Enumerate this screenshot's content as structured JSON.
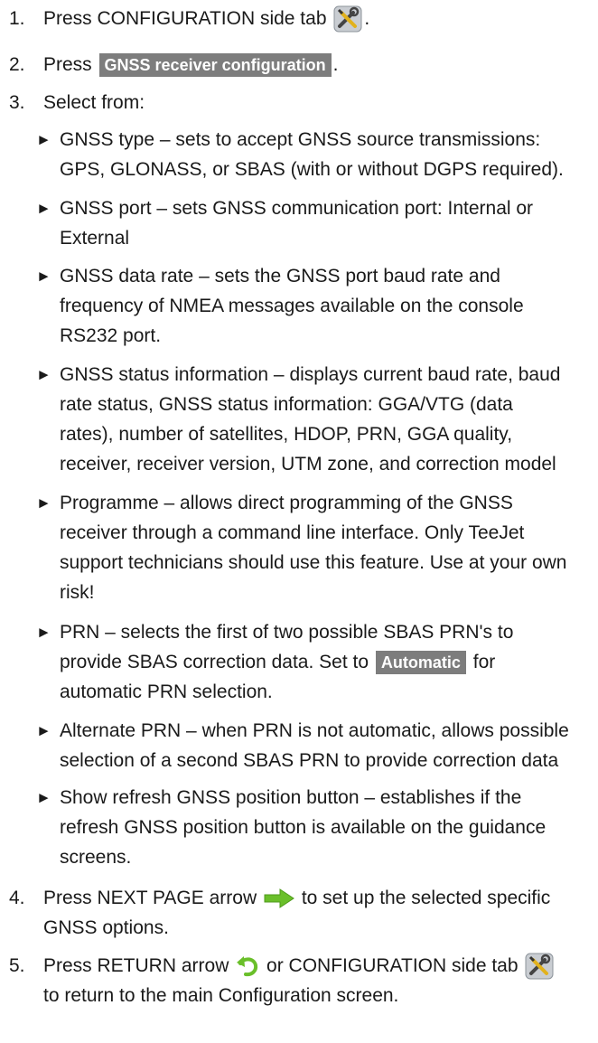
{
  "steps": [
    {
      "num": "1.",
      "parts": [
        "Press CONFIGURATION side tab",
        "."
      ]
    },
    {
      "num": "2.",
      "parts": [
        "Press",
        "."
      ],
      "button": "GNSS receiver configuration"
    },
    {
      "num": "3.",
      "text": "Select from:"
    },
    {
      "num": "4.",
      "parts": [
        "Press NEXT PAGE arrow",
        "to set up the selected specific",
        "GNSS options."
      ]
    },
    {
      "num": "5.",
      "parts": [
        "Press RETURN arrow",
        "or CONFIGURATION side tab",
        "to return to the main Configuration screen."
      ]
    }
  ],
  "bullets": [
    {
      "lines": [
        "GNSS type – sets to accept GNSS source transmissions:",
        "GPS, GLONASS, or SBAS (with or without DGPS required)."
      ]
    },
    {
      "lines": [
        "GNSS port – sets GNSS communication port: Internal or",
        "External"
      ]
    },
    {
      "lines": [
        "GNSS data rate – sets the GNSS port baud rate and",
        "frequency of NMEA messages available on the console",
        "RS232 port."
      ]
    },
    {
      "lines": [
        "GNSS status information – displays current baud rate, baud",
        "rate status, GNSS status information: GGA/VTG (data",
        "rates), number of satellites, HDOP, PRN, GGA quality,",
        "receiver, receiver version, UTM zone, and correction model"
      ]
    },
    {
      "lines": [
        "Programme – allows direct programming of the GNSS",
        "receiver through a command line interface. Only TeeJet",
        "support technicians should use this feature. Use at your own",
        "risk!"
      ]
    },
    {
      "lines": [
        "PRN – selects the first of two possible SBAS PRN's to",
        "provide SBAS correction data. Set to",
        "for",
        "automatic PRN selection."
      ],
      "button": "Automatic"
    },
    {
      "lines": [
        "Alternate PRN – when PRN is not automatic, allows possible",
        "selection of a second SBAS PRN to provide correction data"
      ]
    },
    {
      "lines": [
        "Show refresh GNSS position button – establishes if the",
        "refresh GNSS position button is available on the guidance",
        "screens."
      ]
    }
  ],
  "bullet_marker": "►",
  "icons": {
    "config": "wrench-screwdriver-icon",
    "next": "green-right-arrow-icon",
    "return": "green-return-arrow-icon"
  },
  "colors": {
    "button_bg": "#7d7d7d",
    "button_text": "#ffffff",
    "arrow_green": "#6abf2a"
  }
}
